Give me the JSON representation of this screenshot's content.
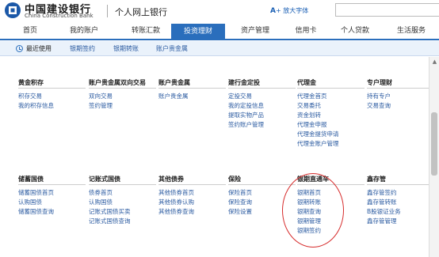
{
  "header": {
    "brand_cn": "中国建设银行",
    "brand_en": "China Construction Bank",
    "subtitle": "个人网上银行",
    "font_enlarge_prefix": "A",
    "font_enlarge_label": "放大字体"
  },
  "nav": [
    {
      "label": "首页"
    },
    {
      "label": "我的账户"
    },
    {
      "label": "转账汇款"
    },
    {
      "label": "投资理财",
      "active": true
    },
    {
      "label": "资产管理"
    },
    {
      "label": "信用卡"
    },
    {
      "label": "个人贷款"
    },
    {
      "label": "生活服务"
    }
  ],
  "subnav": [
    {
      "label": "最近使用",
      "icon": "clock-icon"
    },
    {
      "label": "银期签约"
    },
    {
      "label": "银期转账"
    },
    {
      "label": "账户贵金属"
    }
  ],
  "categories": [
    {
      "title": "黄金积存",
      "links": [
        "积存交易",
        "我的积存信息"
      ]
    },
    {
      "title": "账户贵金属双向交易",
      "links": [
        "双向交易",
        "签约管理"
      ]
    },
    {
      "title": "账户贵金属",
      "links": [
        "账户贵金属"
      ]
    },
    {
      "title": "建行金定投",
      "links": [
        "定投交易",
        "我的定投信息",
        "提取实物产品",
        "签约账户管理"
      ]
    },
    {
      "title": "代理金",
      "links": [
        "代理金首页",
        "交易委托",
        "资金划转",
        "代理金申报",
        "代理金提货申请",
        "代理金账户管理"
      ]
    },
    {
      "title": "专户理财",
      "links": [
        "持有专户",
        "交易查询"
      ]
    },
    {
      "title": "储蓄国债",
      "links": [
        "储蓄国债首页",
        "认购国债",
        "储蓄国债查询"
      ]
    },
    {
      "title": "记账式国债",
      "links": [
        "债券首页",
        "认购国债",
        "记账式国债买卖",
        "记账式国债查询"
      ]
    },
    {
      "title": "其他债券",
      "links": [
        "其他债券首页",
        "其他债券认购",
        "其他债券查询"
      ]
    },
    {
      "title": "保险",
      "links": [
        "保险首页",
        "保险查询",
        "保险设置"
      ]
    },
    {
      "title": "银期直通车",
      "links": [
        "银期首页",
        "银期转账",
        "银期查询",
        "银期管理",
        "银期签约"
      ]
    },
    {
      "title": "鑫存管",
      "links": [
        "鑫存管签约",
        "鑫存管转账",
        "B股银证业务",
        "鑫存管管理"
      ]
    }
  ],
  "colors": {
    "accent": "#2a6ebc",
    "annotation": "#d62b2b"
  }
}
